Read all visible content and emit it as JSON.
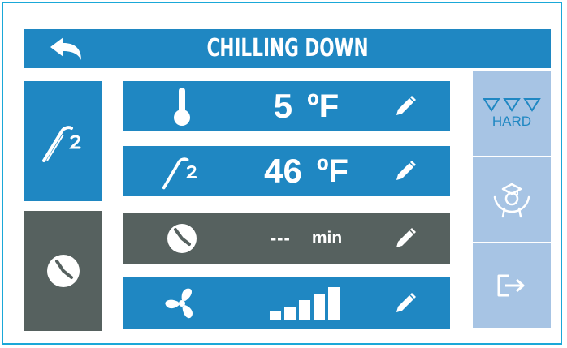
{
  "header": {
    "title": "CHILLING DOWN"
  },
  "side": {
    "probe_mode": "probe",
    "timer_mode": "timer"
  },
  "rows": [
    {
      "icon": "thermometer-icon",
      "value": "5",
      "unit": "ºF"
    },
    {
      "icon": "probe-icon",
      "value": "46",
      "unit": "ºF"
    },
    {
      "icon": "clock-icon",
      "value": "---",
      "unit": "min"
    },
    {
      "icon": "fan-icon",
      "level": 5,
      "max_level": 5
    }
  ],
  "right": {
    "hardness_label": "HARD",
    "hardness_level": 3
  },
  "colors": {
    "blue": "#1f87c2",
    "gray": "#56615f",
    "light_blue": "#a7c4e4",
    "border": "#1aa8d8"
  }
}
